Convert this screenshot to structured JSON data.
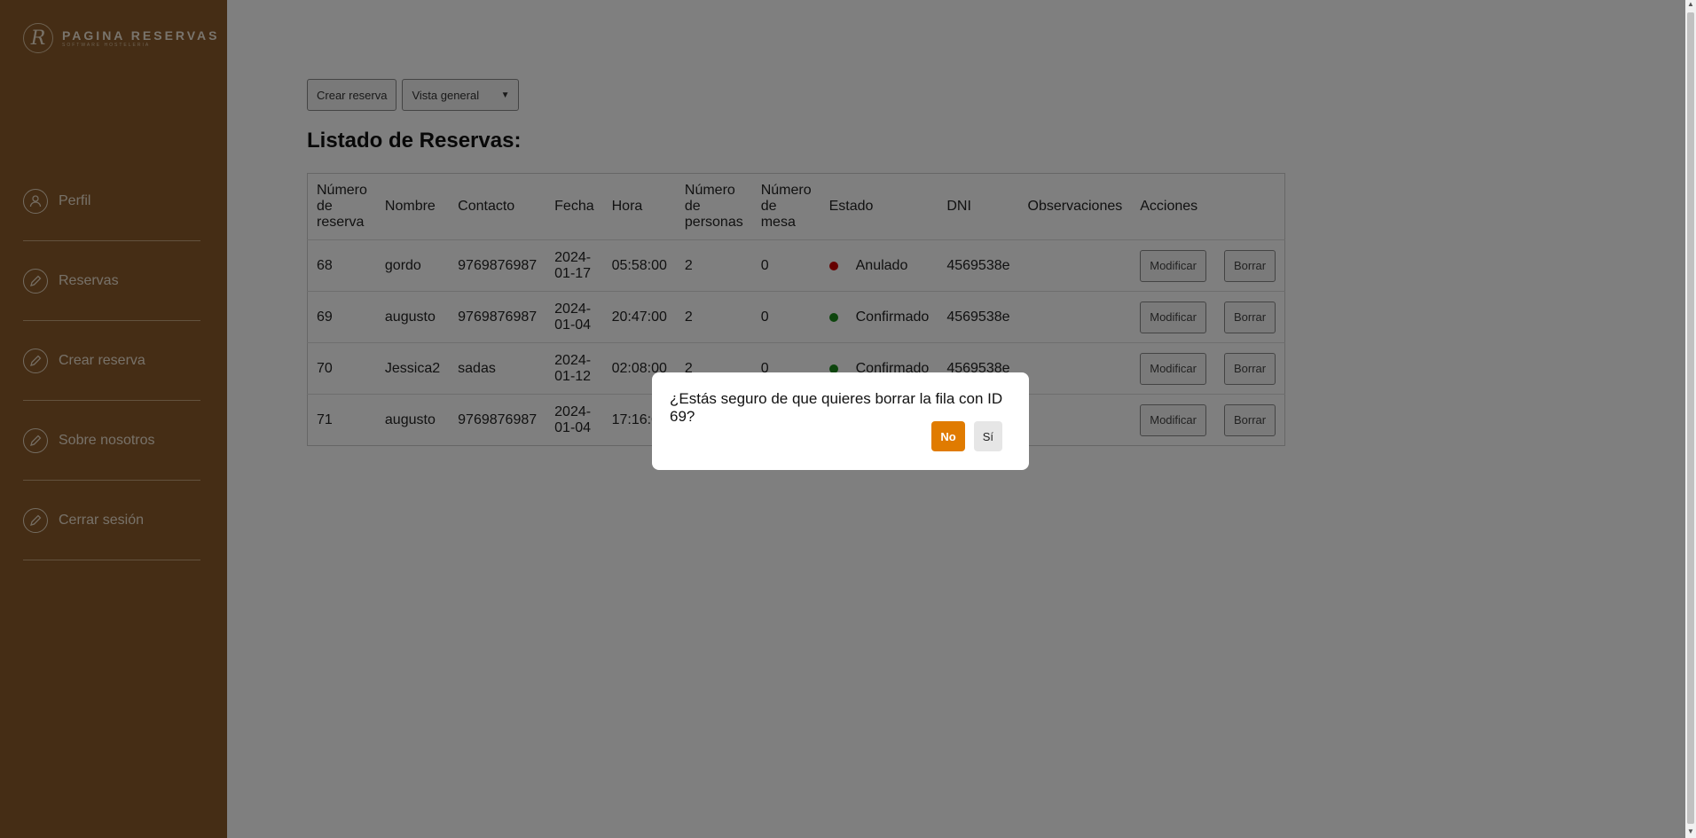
{
  "brand": {
    "title": "PAGINA RESERVAS",
    "subtitle": "SOFTWARE HOSTELERIA",
    "mark": "R"
  },
  "sidebar": {
    "items": [
      {
        "label": "Perfil",
        "icon": "user-icon"
      },
      {
        "label": "Reservas",
        "icon": "pencil-icon"
      },
      {
        "label": "Crear reserva",
        "icon": "pencil-icon"
      },
      {
        "label": "Sobre nosotros",
        "icon": "pencil-icon"
      },
      {
        "label": "Cerrar sesión",
        "icon": "pencil-icon"
      }
    ]
  },
  "toolbar": {
    "create_label": "Crear reserva",
    "view_select": "Vista general"
  },
  "page_title": "Listado de Reservas:",
  "table": {
    "headers": [
      "Número de reserva",
      "Nombre",
      "Contacto",
      "Fecha",
      "Hora",
      "Número de personas",
      "Número de mesa",
      "Estado",
      "DNI",
      "Observaciones",
      "Acciones"
    ],
    "rows": [
      {
        "id": "68",
        "nombre": "gordo",
        "contacto": "9769876987",
        "fecha": "2024-01-17",
        "hora": "05:58:00",
        "personas": "2",
        "mesa": "0",
        "estado": "Anulado",
        "estado_color": "#cc0000",
        "dni": "4569538e",
        "obs": "",
        "modificar": "Modificar",
        "borrar": "Borrar"
      },
      {
        "id": "69",
        "nombre": "augusto",
        "contacto": "9769876987",
        "fecha": "2024-01-04",
        "hora": "20:47:00",
        "personas": "2",
        "mesa": "0",
        "estado": "Confirmado",
        "estado_color": "#1a8a1a",
        "dni": "4569538e",
        "obs": "",
        "modificar": "Modificar",
        "borrar": "Borrar"
      },
      {
        "id": "70",
        "nombre": "Jessica2",
        "contacto": "sadas",
        "fecha": "2024-01-12",
        "hora": "02:08:00",
        "personas": "2",
        "mesa": "0",
        "estado": "Confirmado",
        "estado_color": "#1a8a1a",
        "dni": "4569538e",
        "obs": "",
        "modificar": "Modificar",
        "borrar": "Borrar"
      },
      {
        "id": "71",
        "nombre": "augusto",
        "contacto": "9769876987",
        "fecha": "2024-01-04",
        "hora": "17:16:00",
        "personas": "",
        "mesa": "",
        "estado": "",
        "estado_color": "",
        "dni": "",
        "obs": "",
        "modificar": "Modificar",
        "borrar": "Borrar"
      }
    ]
  },
  "modal": {
    "message": "¿Estás seguro de que quieres borrar la fila con ID 69?",
    "no_label": "No",
    "yes_label": "Sí"
  },
  "colors": {
    "sidebar": "#8a5a2a",
    "accent": "#e07b00",
    "anulado": "#cc0000",
    "confirmado": "#1a8a1a"
  }
}
